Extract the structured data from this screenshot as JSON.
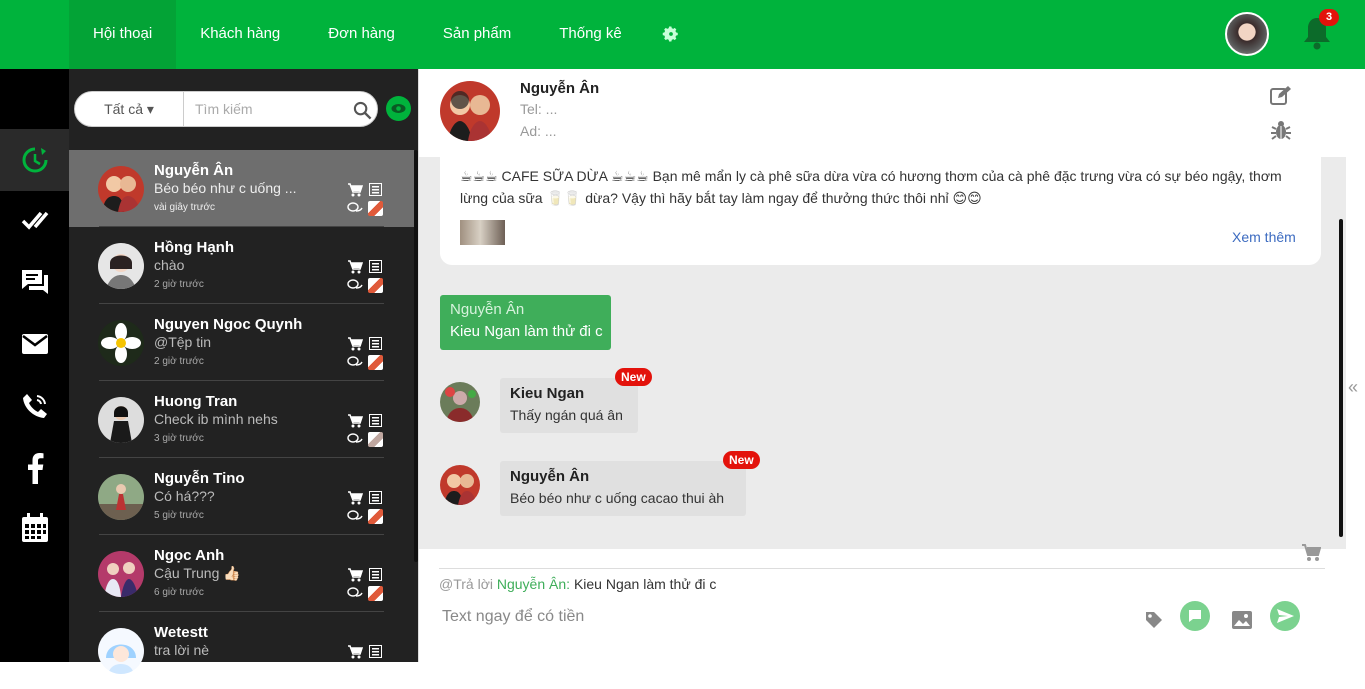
{
  "nav": {
    "tabs": [
      "Hội thoại",
      "Khách hàng",
      "Đơn hàng",
      "Sản phẩm",
      "Thống kê"
    ],
    "active_tab": "Hội thoại",
    "notification_count": "3"
  },
  "colors": {
    "brand": "#00b33c",
    "badge": "#e3120b",
    "link": "#3c6bc0"
  },
  "sidebar_icons": [
    "clock-refresh-icon",
    "check-all-icon",
    "chat-icon",
    "mail-icon",
    "phone-icon",
    "facebook-icon",
    "calendar-icon"
  ],
  "filter": {
    "select_value": "Tất cả",
    "search_placeholder": "Tìm kiếm"
  },
  "conversations": [
    {
      "name": "Nguyễn Ân",
      "preview": "Béo béo như c uống ...",
      "time": "vài giây trước"
    },
    {
      "name": "Hồng Hạnh",
      "preview": "chào",
      "time": "2 giờ trước"
    },
    {
      "name": "Nguyen Ngoc Quynh",
      "preview": "@Tệp tin",
      "time": "2 giờ trước"
    },
    {
      "name": "Huong Tran",
      "preview": "Check ib mình nehs",
      "time": "3 giờ trước"
    },
    {
      "name": "Nguyễn Tino",
      "preview": "Có há???",
      "time": "5 giờ trước"
    },
    {
      "name": "Ngọc Anh",
      "preview": "Cậu Trung 👍🏻",
      "time": "6 giờ trước"
    },
    {
      "name": "Wetestt",
      "preview": "tra lời nè",
      "time": ""
    }
  ],
  "header": {
    "name": "Nguyễn Ân",
    "tel": "Tel: ...",
    "ad": "Ad: ..."
  },
  "post": {
    "text": "☕☕☕ CAFE SỮA DỪA ☕☕☕ Bạn mê mẩn ly cà phê sữa dừa vừa có hương thơm của cà phê đặc trưng vừa có sự béo ngậy, thơm lừng của sữa 🥛🥛 dừa? Vậy thì hãy bắt tay làm ngay để thưởng thức thôi nhỉ 😊😊",
    "more": "Xem thêm"
  },
  "messages": {
    "outgoing": {
      "name": "Nguyễn Ân",
      "text": "Kieu Ngan làm thử đi c"
    },
    "in1": {
      "name": "Kieu Ngan",
      "text": "Thấy ngán quá ân",
      "badge": "New"
    },
    "in2": {
      "name": "Nguyễn Ân",
      "text": "Béo béo như c uống cacao thui àh",
      "badge": "New"
    }
  },
  "reply": {
    "prefix": "@Trả lời",
    "who": "Nguyễn Ân:",
    "msg": "Kieu Ngan làm thử đi c"
  },
  "composer": {
    "placeholder": "Text ngay để có tiền"
  }
}
